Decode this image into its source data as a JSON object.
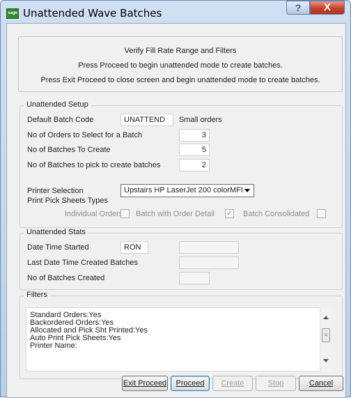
{
  "window": {
    "title": "Unattended Wave Batches",
    "app_icon_text": "sage",
    "help_glyph": "?",
    "close_glyph": "X"
  },
  "info": {
    "line1": "Verify Fill Rate Range and Filters",
    "line2": "Press Proceed to begin unattended mode to create batches.",
    "line3": "Press Exit Proceed to close screen and begin unattended mode to create batches."
  },
  "setup": {
    "group_title": "Unattended Setup",
    "default_batch_code_label": "Default Batch Code",
    "default_batch_code_value": "UNATTEND",
    "default_batch_code_desc": "Small orders",
    "orders_per_batch_label": "No of Orders to Select for a Batch",
    "orders_per_batch_value": "3",
    "batches_to_create_label": "No of Batches To Create",
    "batches_to_create_value": "5",
    "batches_to_pick_label": "No of Batches to pick to create batches",
    "batches_to_pick_value": "2",
    "printer_label": "Printer Selection",
    "printer_value": "Upstairs HP LaserJet 200 colorMFI",
    "pick_sheet_types_label": "Print Pick Sheets Types",
    "individual_orders_label": "Individual Orders",
    "individual_orders_checked": "",
    "batch_order_detail_label": "Batch with Order Detail",
    "batch_order_detail_checked": "✓",
    "batch_consolidated_label": "Batch Consolidated",
    "batch_consolidated_checked": ""
  },
  "stats": {
    "group_title": "Unattended Stats",
    "date_started_label": "Date Time Started",
    "date_started_user": "RON",
    "date_started_value": "",
    "last_created_label": "Last Date Time Created Batches",
    "last_created_value": "",
    "batches_created_label": "No of Batches Created",
    "batches_created_value": ""
  },
  "filters": {
    "group_title": "Filters",
    "lines": [
      "Standard Orders:Yes",
      "Backordered Orders:Yes",
      "Allocated and Pick Sht Printed:Yes",
      "Auto Print Pick Sheets:Yes",
      "Printer Name:"
    ]
  },
  "buttons": {
    "exit_proceed": "Exit Proceed",
    "proceed": "Proceed",
    "create": "Create",
    "stop": "Stop",
    "cancel": "Cancel"
  },
  "icons": {
    "help": "help-icon",
    "close": "close-icon",
    "dropdown": "chevron-down-icon",
    "scroll_up": "scroll-up-icon",
    "scroll_down": "scroll-down-icon"
  }
}
